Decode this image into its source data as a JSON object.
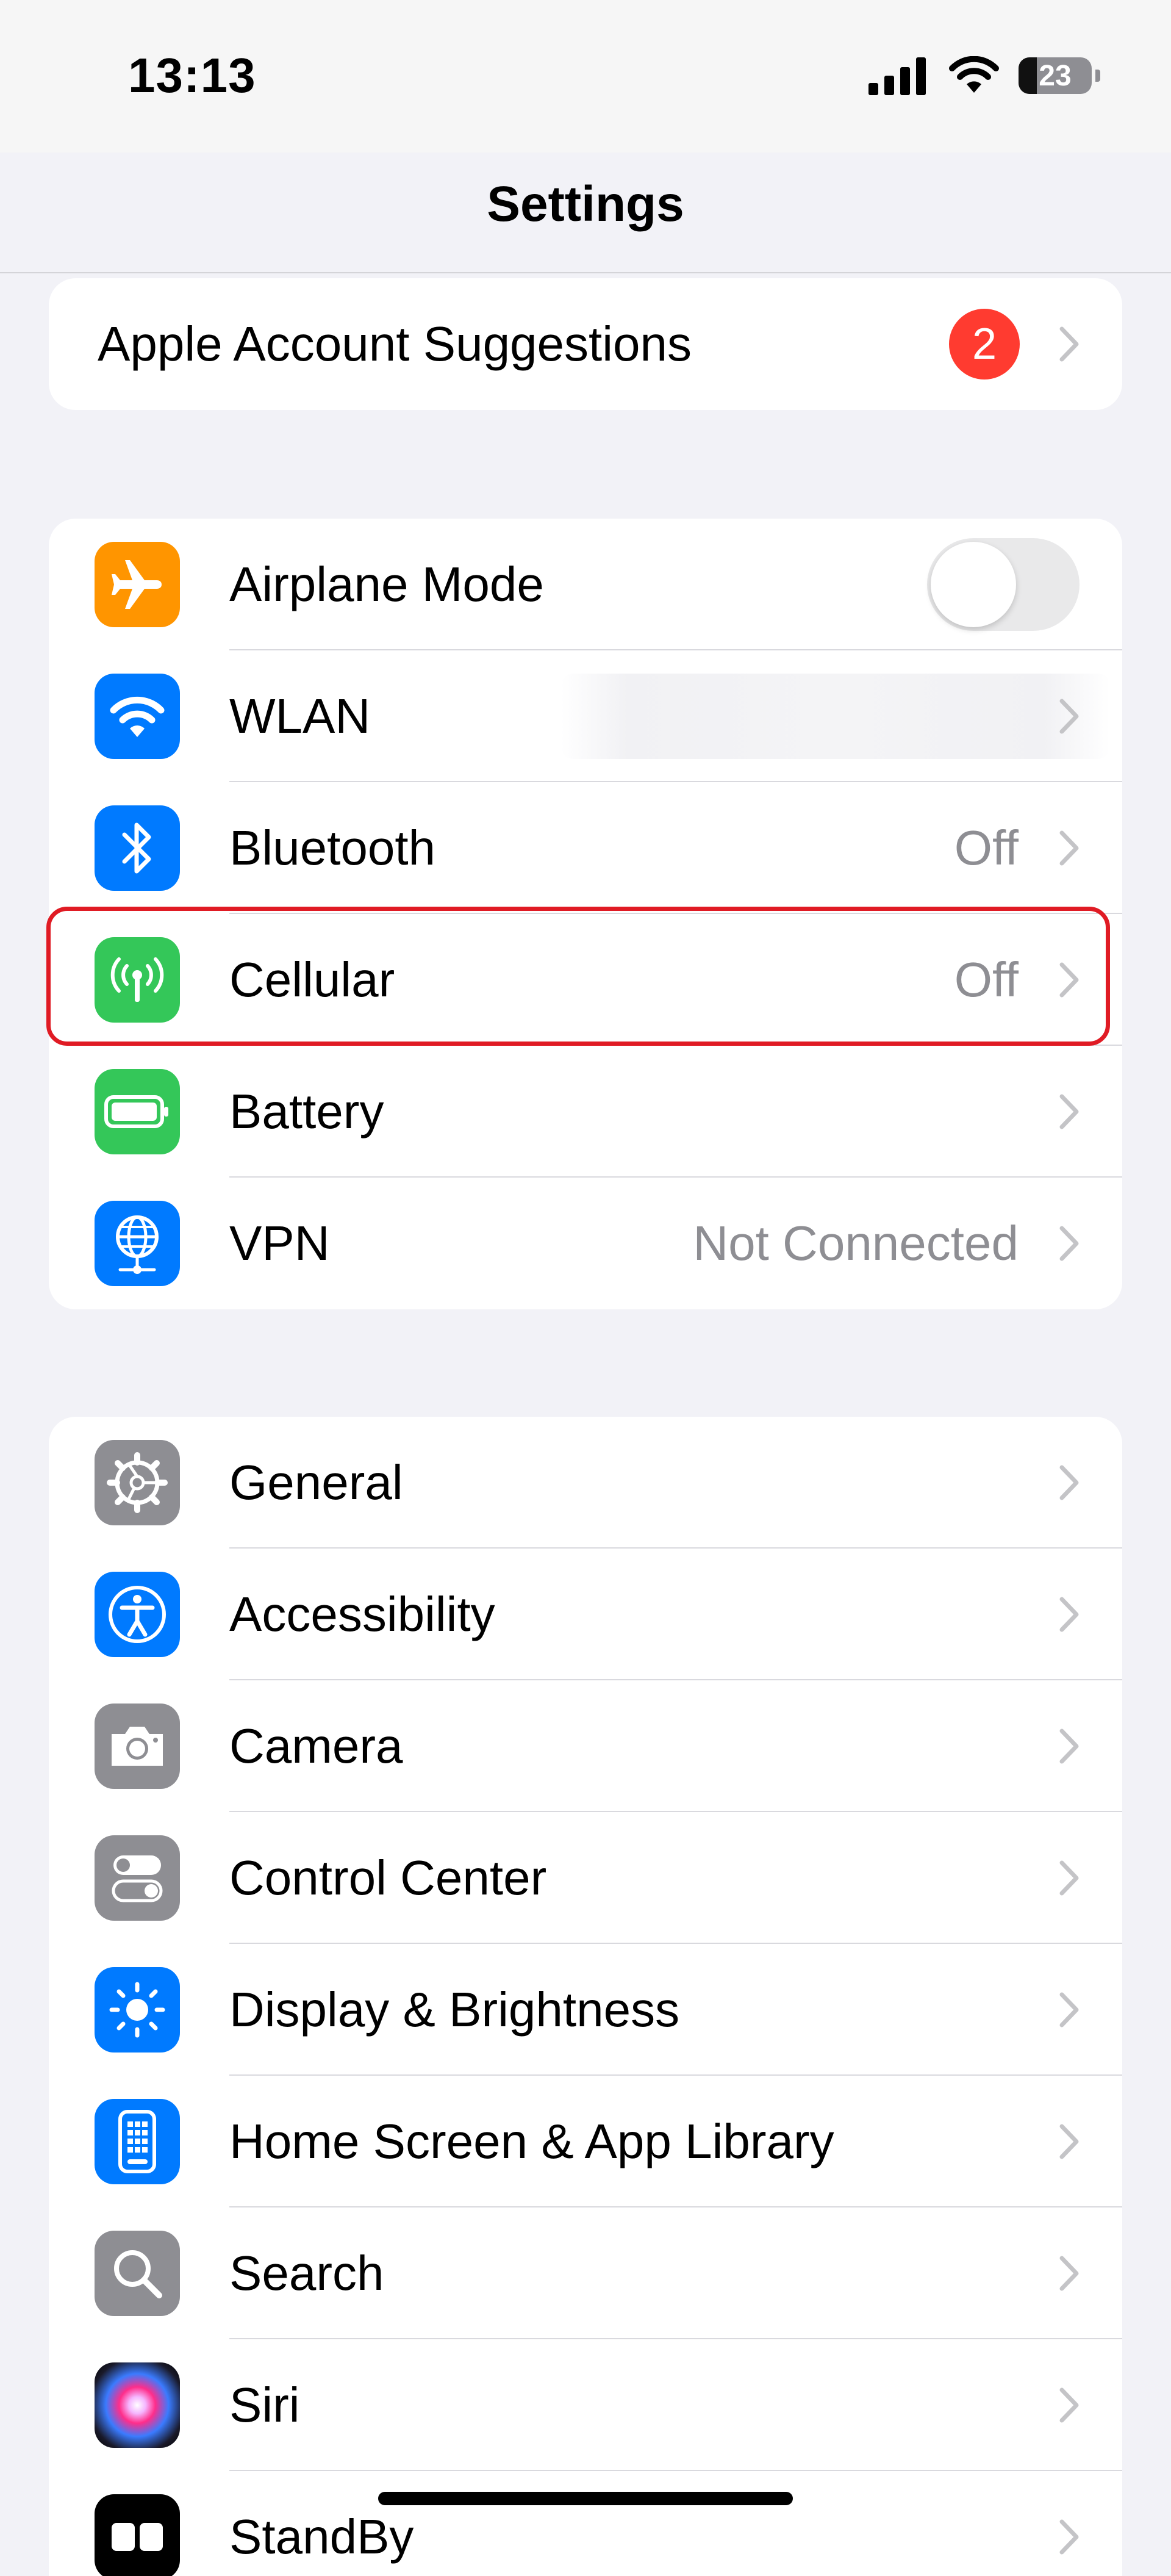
{
  "status": {
    "time": "13:13",
    "battery_level": "23"
  },
  "nav": {
    "title": "Settings"
  },
  "account": {
    "label": "Apple Account Suggestions",
    "badge_count": "2"
  },
  "connectivity": [
    {
      "label": "Airplane Mode",
      "icon": "airplane-icon",
      "color": "#ff9500",
      "toggle_on": false
    },
    {
      "label": "WLAN",
      "icon": "wifi-icon",
      "color": "#007aff",
      "value": ""
    },
    {
      "label": "Bluetooth",
      "icon": "bluetooth-icon",
      "color": "#007aff",
      "value": "Off"
    },
    {
      "label": "Cellular",
      "icon": "antenna-icon",
      "color": "#34c759",
      "value": "Off"
    },
    {
      "label": "Battery",
      "icon": "battery-icon",
      "color": "#34c759"
    },
    {
      "label": "VPN",
      "icon": "globe-icon",
      "color": "#007aff",
      "value": "Not Connected"
    }
  ],
  "system": [
    {
      "label": "General",
      "icon": "gear-icon",
      "color": "#8e8e93"
    },
    {
      "label": "Accessibility",
      "icon": "accessibility-icon",
      "color": "#007aff"
    },
    {
      "label": "Camera",
      "icon": "camera-icon",
      "color": "#8e8e93"
    },
    {
      "label": "Control Center",
      "icon": "switches-icon",
      "color": "#8e8e93"
    },
    {
      "label": "Display & Brightness",
      "icon": "sun-icon",
      "color": "#007aff"
    },
    {
      "label": "Home Screen & App Library",
      "icon": "phone-grid-icon",
      "color": "#007aff"
    },
    {
      "label": "Search",
      "icon": "magnifier-icon",
      "color": "#8e8e93"
    },
    {
      "label": "Siri",
      "icon": "siri-icon",
      "color": "#1c1c1e"
    },
    {
      "label": "StandBy",
      "icon": "standby-icon",
      "color": "#000000"
    }
  ],
  "highlight_color": "#e01b24"
}
